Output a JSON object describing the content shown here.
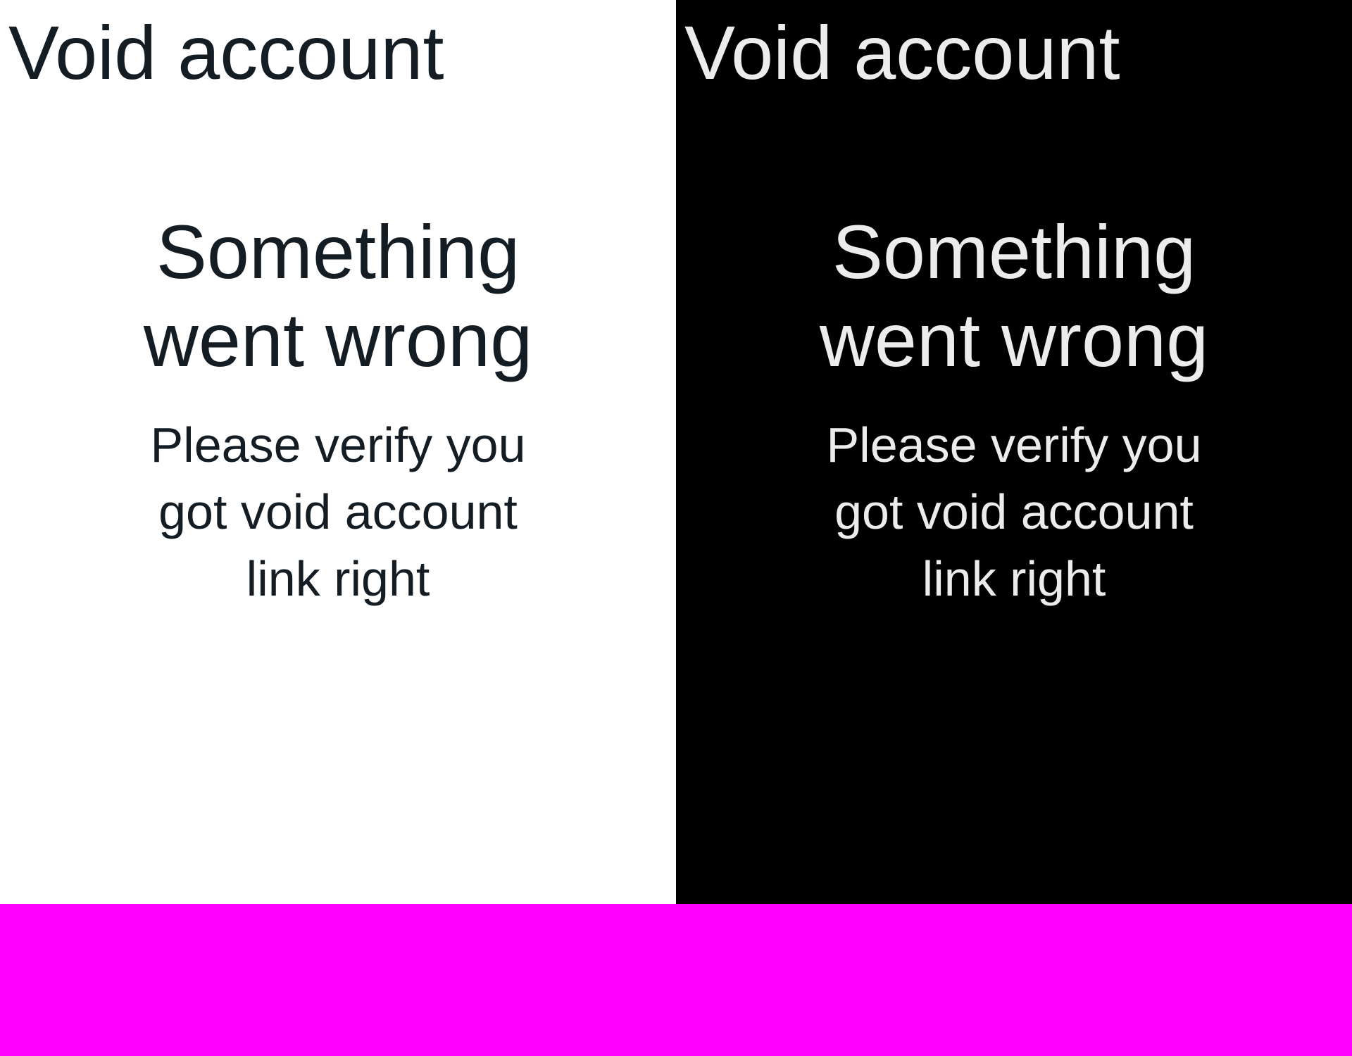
{
  "light_panel": {
    "app_title": "Void account",
    "error_title": "Something went wrong",
    "error_message": "Please verify you got void account link right"
  },
  "dark_panel": {
    "app_title": "Void account",
    "error_title": "Something went wrong",
    "error_message": "Please verify you got void account link right"
  },
  "colors": {
    "light_background": "#ffffff",
    "light_text": "#141c24",
    "dark_background": "#000000",
    "dark_text": "#ececec",
    "bottom_strip": "#ff00ff"
  }
}
